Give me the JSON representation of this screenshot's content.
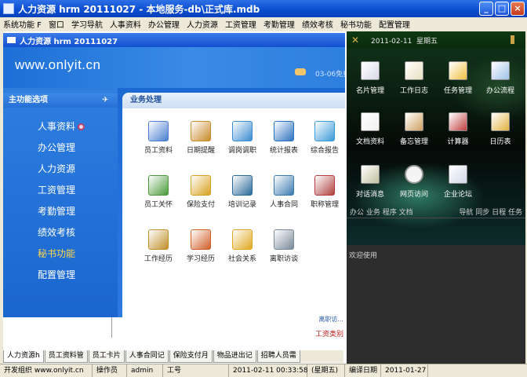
{
  "window": {
    "title": "人力资源 hrm 20111027 - 本地服务-db\\正式库.mdb",
    "controls": [
      "_",
      "□",
      "×"
    ]
  },
  "menubar": [
    "系统功能 F",
    "窗口",
    "学习导航",
    "人事资料",
    "办公管理",
    "人力资源",
    "工资管理",
    "考勤管理",
    "绩效考核",
    "秘书功能",
    "配置管理"
  ],
  "inner": {
    "title": "人力资源 hrm 20111027",
    "site": "www.onlyit.cn",
    "date_fragment": "03-06免费"
  },
  "leftpanel": {
    "heading": "主功能选项",
    "items": [
      {
        "label": "人事资料"
      },
      {
        "label": "办公管理"
      },
      {
        "label": "人力资源"
      },
      {
        "label": "工资管理"
      },
      {
        "label": "考勤管理"
      },
      {
        "label": "绩效考核"
      },
      {
        "label": "秘书功能"
      },
      {
        "label": "配置管理"
      }
    ],
    "active_index": 6
  },
  "business": {
    "heading": "业务处理",
    "tiles": [
      {
        "label": "员工资料",
        "icon": "employee-file-icon",
        "color": "#4a7fd0"
      },
      {
        "label": "日期提醒",
        "icon": "date-reminder-icon",
        "color": "#c88a2a"
      },
      {
        "label": "调岗调职",
        "icon": "magnifier-icon",
        "color": "#3a8bd0"
      },
      {
        "label": "统计报表",
        "icon": "statistics-icon",
        "color": "#2c72c0"
      },
      {
        "label": "综合报告",
        "icon": "report-icon",
        "color": "#3a9ad8"
      },
      {
        "label": "员工关怀",
        "icon": "care-icon",
        "color": "#4a9a3a"
      },
      {
        "label": "保险支付",
        "icon": "insurance-icon",
        "color": "#d8a020"
      },
      {
        "label": "培训记录",
        "icon": "training-icon",
        "color": "#2a6a9a"
      },
      {
        "label": "人事合同",
        "icon": "contract-icon",
        "color": "#3a7ab0"
      },
      {
        "label": "职称管理",
        "icon": "title-manage-icon",
        "color": "#b04040"
      },
      {
        "label": "工作经历",
        "icon": "work-history-icon",
        "color": "#c0902a"
      },
      {
        "label": "学习经历",
        "icon": "study-history-icon",
        "color": "#d0602a"
      },
      {
        "label": "社会关系",
        "icon": "social-folder-icon",
        "color": "#e0a820"
      },
      {
        "label": "离职访谈",
        "icon": "megaphone-icon",
        "color": "#7a8a9a"
      }
    ]
  },
  "under": {
    "line1": "离职访...",
    "line2": "工资类别"
  },
  "bottom_tabs": [
    "人力资源h",
    "员工资料管",
    "员工卡片",
    "人事合同记",
    "保险支付月",
    "物品进出记",
    "招聘人员需"
  ],
  "statusbar": {
    "developer": "开发组织 www.onlyit.cn",
    "operator_label": "操作员",
    "operator": "admin",
    "job_no_label": "工号",
    "datetime": "2011-02-11 00:33:58",
    "weekday": "(星期五)",
    "compile_label": "编译日期",
    "compile_date": "2011-01-27"
  },
  "rightpanel": {
    "date": "2011-02-11",
    "weekday": "星期五",
    "tiles": [
      {
        "label": "名片管理",
        "icon": "business-card-icon"
      },
      {
        "label": "工作日志",
        "icon": "work-log-icon"
      },
      {
        "label": "任务管理",
        "icon": "task-icon"
      },
      {
        "label": "办公流程",
        "icon": "workflow-icon"
      },
      {
        "label": "文档资料",
        "icon": "document-icon"
      },
      {
        "label": "备忘管理",
        "icon": "memo-icon"
      },
      {
        "label": "计算器",
        "icon": "calculator-icon"
      },
      {
        "label": "日历表",
        "icon": "calendar-chip-icon"
      },
      {
        "label": "对话消息",
        "icon": "swords-icon"
      },
      {
        "label": "网页访问",
        "icon": "clock-icon"
      },
      {
        "label": "企业论坛",
        "icon": "forum-icon"
      }
    ],
    "cats_left": "办公 业务 程序 文档",
    "cats_right": "导航 同步 日程 任务",
    "welcome": "欢迎使用"
  }
}
